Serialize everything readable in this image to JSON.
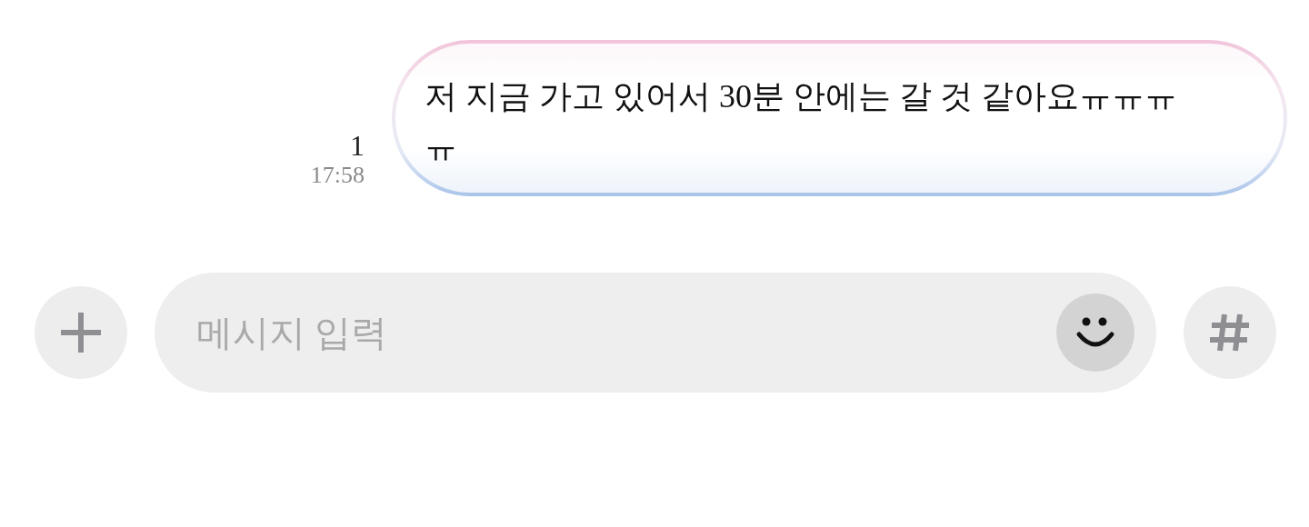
{
  "messages": [
    {
      "text": "저 지금 가고 있어서 30분 안에는 갈 것 같아요ㅠㅠㅠㅠ",
      "unread_count": "1",
      "time": "17:58",
      "outgoing": true
    }
  ],
  "composer": {
    "placeholder": "메시지 입력"
  }
}
